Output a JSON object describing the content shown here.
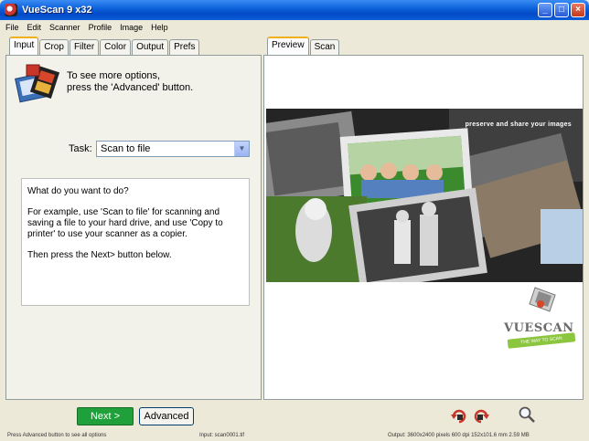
{
  "window": {
    "title": "VueScan 9 x32"
  },
  "menu": [
    "File",
    "Edit",
    "Scanner",
    "Profile",
    "Image",
    "Help"
  ],
  "left_tabs": [
    {
      "label": "Input",
      "active": true
    },
    {
      "label": "Crop",
      "active": false
    },
    {
      "label": "Filter",
      "active": false
    },
    {
      "label": "Color",
      "active": false
    },
    {
      "label": "Output",
      "active": false
    },
    {
      "label": "Prefs",
      "active": false
    }
  ],
  "options_hint": {
    "line1": "To see more options,",
    "line2": "press the 'Advanced' button."
  },
  "task": {
    "label": "Task:",
    "value": "Scan to file"
  },
  "help": {
    "p1": "What do you want to do?",
    "p2": "For example, use 'Scan to file' for scanning and saving a file to your hard drive, and use 'Copy to printer' to use your scanner as a copier.",
    "p3": "Then press the Next> button below."
  },
  "right_tabs": [
    {
      "label": "Preview",
      "active": true
    },
    {
      "label": "Scan",
      "active": false
    }
  ],
  "preview": {
    "tagline": "preserve and share your images",
    "logo_text": "VUESCAN",
    "logo_sub": "THE WAY TO SCAN"
  },
  "buttons": {
    "next": "Next >",
    "advanced": "Advanced"
  },
  "icons": {
    "rotate_left": "rotate-left-icon",
    "rotate_right": "rotate-right-icon",
    "zoom": "magnifier-icon"
  },
  "status": {
    "left": "Press Advanced button to see all options",
    "mid": "Input: scan0001.tif",
    "right": "Output: 3600x2400 pixels 600 dpi 152x101.6 mm 2.59 MB"
  },
  "colors": {
    "next_button": "#1fa03a",
    "titlebar": "#0a5fd8",
    "active_tab_accent": "#f2b01c"
  }
}
